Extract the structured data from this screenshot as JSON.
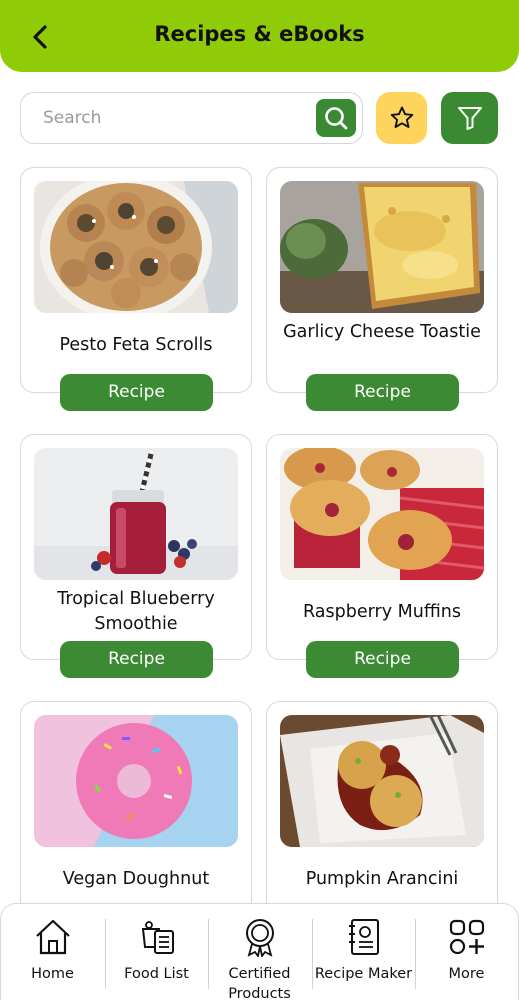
{
  "header": {
    "title": "Recipes & eBooks"
  },
  "search": {
    "placeholder": "Search"
  },
  "cards": [
    {
      "title": "Pesto Feta Scrolls",
      "button": "Recipe"
    },
    {
      "title": "Garlicy Cheese Toastie",
      "button": "Recipe"
    },
    {
      "title": "Tropical Blueberry Smoothie",
      "button": "Recipe"
    },
    {
      "title": "Raspberry Muffins",
      "button": "Recipe"
    },
    {
      "title": "Vegan Doughnut"
    },
    {
      "title": "Pumpkin Arancini"
    }
  ],
  "nav": [
    {
      "label": "Home",
      "icon": "home-icon"
    },
    {
      "label": "Food List",
      "icon": "food-list-icon"
    },
    {
      "label": "Certified Products",
      "icon": "certified-badge-icon"
    },
    {
      "label": "Recipe Maker",
      "icon": "recipe-book-icon"
    },
    {
      "label": "More",
      "icon": "grid-plus-icon"
    }
  ],
  "colors": {
    "header": "#8fcc07",
    "primary_green": "#3a8a34",
    "favorite_yellow": "#ffd45c"
  }
}
